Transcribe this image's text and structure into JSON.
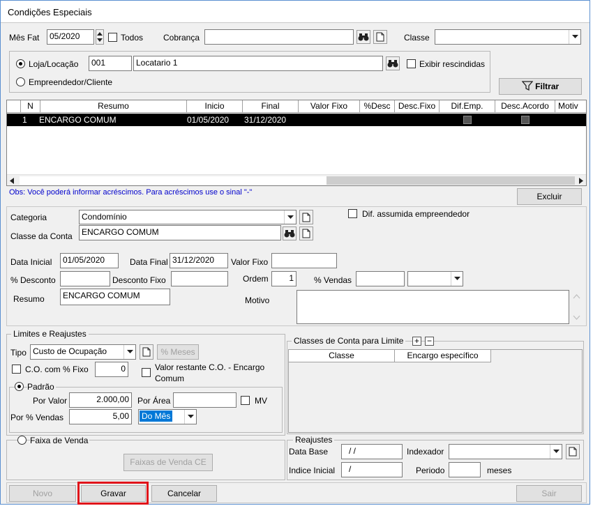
{
  "window": {
    "title": "Condições Especiais"
  },
  "filters": {
    "mes_fat_label": "Mês Fat",
    "mes_fat_value": "05/2020",
    "todos_label": "Todos",
    "cobranca_label": "Cobrança",
    "cobranca_value": "",
    "classe_label": "Classe",
    "classe_value": "",
    "loja_label": "Loja/Locação",
    "loja_code": "001",
    "loja_name": "Locatario 1",
    "exibir_rescindidas_label": "Exibir rescindidas",
    "empreendedor_label": "Empreendedor/Cliente",
    "filtrar_label": "Filtrar",
    "selected_option": "Loja/Locação"
  },
  "grid": {
    "columns": [
      "N",
      "Resumo",
      "Inicio",
      "Final",
      "Valor Fixo",
      "%Desc",
      "Desc.Fixo",
      "Dif.Emp.",
      "Desc.Acordo",
      "Motiv"
    ],
    "rows": [
      {
        "n": "1",
        "resumo": "ENCARGO COMUM",
        "inicio": "01/05/2020",
        "final": "31/12/2020",
        "valor_fixo": "",
        "desc": "",
        "desc_fixo": "",
        "dif_emp": false,
        "desc_acordo": false,
        "motivo": ""
      }
    ]
  },
  "obs_text": "Obs: Você poderá informar acréscimos. Para acréscimos use o sinal \"-\"",
  "excluir_label": "Excluir",
  "detail": {
    "categoria_label": "Categoria",
    "categoria_value": "Condomínio",
    "dif_assumida_label": "Dif. assumida empreendedor",
    "classe_conta_label": "Classe da Conta",
    "classe_conta_value": "ENCARGO COMUM",
    "data_inicial_label": "Data Inicial",
    "data_inicial_value": "01/05/2020",
    "data_final_label": "Data Final",
    "data_final_value": "31/12/2020",
    "valor_fixo_label": "Valor Fixo",
    "valor_fixo_value": "",
    "desconto_label": "% Desconto",
    "desconto_value": "",
    "desconto_fixo_label": "Desconto Fixo",
    "desconto_fixo_value": "",
    "ordem_label": "Ordem",
    "ordem_value": "1",
    "vendas_label": "% Vendas",
    "vendas_value": "",
    "vendas_select": "",
    "resumo_label": "Resumo",
    "resumo_value": "ENCARGO COMUM",
    "motivo_label": "Motivo",
    "motivo_value": ""
  },
  "limites": {
    "legend": "Limites e Reajustes",
    "tipo_label": "Tipo",
    "tipo_value": "Custo de Ocupação",
    "meses_label": "% Meses",
    "co_fixo_label": "C.O. com % Fixo",
    "co_fixo_value": "0",
    "valor_restante_label_1": "Valor restante C.O. - Encargo",
    "valor_restante_label_2": "Comum",
    "padrao_label": "Padrão",
    "por_valor_label": "Por Valor",
    "por_valor_value": "2.000,00",
    "por_area_label": "Por Área",
    "por_area_value": "",
    "mv_label": "MV",
    "por_vendas_label": "Por % Vendas",
    "por_vendas_value": "5,00",
    "periodo_select": "Do Mês",
    "faixa_label": "Faixa de Venda",
    "faixas_button": "Faixas de Venda CE"
  },
  "classes_limite": {
    "legend": "Classes de Conta para Limite",
    "columns": [
      "Classe",
      "Encargo específico"
    ]
  },
  "reajustes": {
    "legend": "Reajustes",
    "data_base_label": "Data Base",
    "data_base_value": "/ /",
    "indexador_label": "Indexador",
    "indexador_value": "",
    "indice_label": "Indice Inicial",
    "indice_value": "/",
    "periodo_label": "Periodo",
    "periodo_value": "",
    "meses_label": "meses"
  },
  "footer": {
    "novo": "Novo",
    "gravar": "Gravar",
    "cancelar": "Cancelar",
    "sair": "Sair"
  },
  "colors": {
    "highlight": "#e0121a",
    "selected_row": "#000000",
    "obs_text": "#0000cc",
    "select_highlight": "#0078d7"
  }
}
